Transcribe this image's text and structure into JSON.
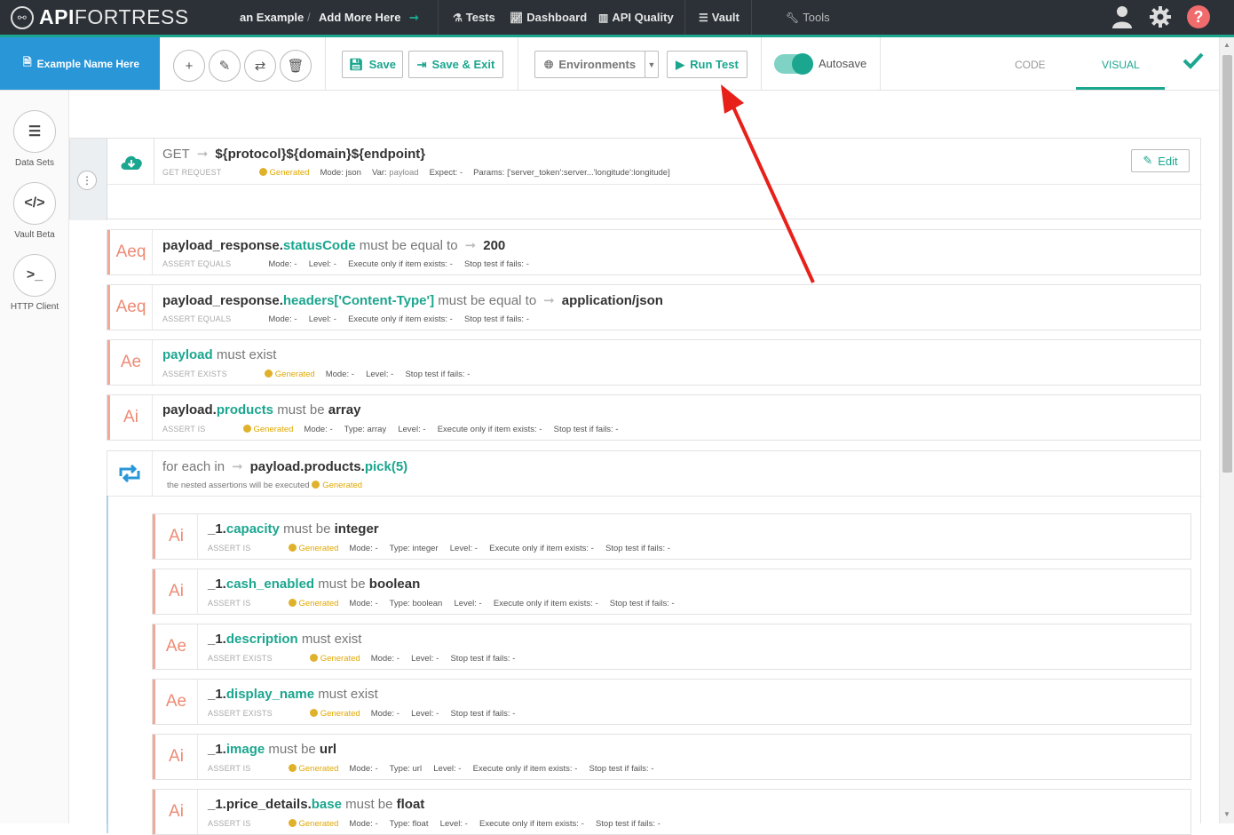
{
  "brand": {
    "bold": "API",
    "thin": "FORTRESS"
  },
  "breadcrumb": {
    "project": "an Example",
    "separator": "/",
    "add": "Add More Here"
  },
  "nav": {
    "tests": "Tests",
    "dashboard": "Dashboard",
    "quality": "API Quality",
    "vault": "Vault",
    "tools": "Tools"
  },
  "test_name": "Example Name Here",
  "toolbar": {
    "save": "Save",
    "save_exit": "Save & Exit",
    "environments": "Environments",
    "run_test": "Run Test",
    "autosave": "Autosave",
    "tab_code": "CODE",
    "tab_visual": "VISUAL"
  },
  "sidebar": {
    "data_sets": "Data Sets",
    "vault": "Vault Beta",
    "http": "HTTP Client"
  },
  "colors": {
    "accent": "#1ba68f",
    "primary": "#2996d8",
    "assert_badge": "#ef8a74",
    "generated": "#e0a800",
    "annotation_arrow": "#e8201a"
  },
  "request": {
    "method": "GET",
    "url": "${protocol}${domain}${endpoint}",
    "caption": "GET REQUEST",
    "generated": "Generated",
    "mode": "Mode: json",
    "var": "Var:",
    "var_val": "payload",
    "expect": "Expect: -",
    "params": "Params: ['server_token':server...'longitude':longitude]",
    "edit": "Edit"
  },
  "rows": [
    {
      "badge": "Aeq",
      "p1": "payload_response.",
      "p2": "statusCode",
      "verb": "must be equal to",
      "value": "200",
      "caption": "ASSERT EQUALS",
      "meta": "Mode: -     Level: -     Execute only if item exists: -     Stop test if fails: -"
    },
    {
      "badge": "Aeq",
      "p1": "payload_response.",
      "p2": "headers['Content-Type']",
      "verb": "must be equal to",
      "value": "application/json",
      "caption": "ASSERT EQUALS",
      "meta": "Mode: -     Level: -     Execute only if item exists: -     Stop test if fails: -"
    },
    {
      "badge": "Ae",
      "p1": "",
      "p2": "payload",
      "verb": "must exist",
      "value": "",
      "caption": "ASSERT EXISTS",
      "meta": "Mode: -     Level: -     Stop test if fails: -"
    },
    {
      "badge": "Ai",
      "p1": "payload.",
      "p2": "products",
      "verb": "must be",
      "value": "array",
      "caption": "ASSERT IS",
      "meta": "Mode: -     Type: array     Level: -     Execute only if item exists: -     Stop test if fails: -"
    }
  ],
  "foreach": {
    "label": "for each in",
    "p1": "payload.products.",
    "p2": "pick(5)",
    "caption": "the nested assertions will be executed",
    "generated": "Generated"
  },
  "nested": [
    {
      "badge": "Ai",
      "p1": "_1.",
      "p2": "capacity",
      "verb": "must be",
      "value": "integer",
      "caption": "ASSERT IS",
      "meta": "Mode: -     Type: integer     Level: -     Execute only if item exists: -     Stop test if fails: -"
    },
    {
      "badge": "Ai",
      "p1": "_1.",
      "p2": "cash_enabled",
      "verb": "must be",
      "value": "boolean",
      "caption": "ASSERT IS",
      "meta": "Mode: -     Type: boolean     Level: -     Execute only if item exists: -     Stop test if fails: -"
    },
    {
      "badge": "Ae",
      "p1": "_1.",
      "p2": "description",
      "verb": "must exist",
      "value": "",
      "caption": "ASSERT EXISTS",
      "meta": "Mode: -     Level: -     Stop test if fails: -"
    },
    {
      "badge": "Ae",
      "p1": "_1.",
      "p2": "display_name",
      "verb": "must exist",
      "value": "",
      "caption": "ASSERT EXISTS",
      "meta": "Mode: -     Level: -     Stop test if fails: -"
    },
    {
      "badge": "Ai",
      "p1": "_1.",
      "p2": "image",
      "verb": "must be",
      "value": "url",
      "caption": "ASSERT IS",
      "meta": "Mode: -     Type: url     Level: -     Execute only if item exists: -     Stop test if fails: -"
    },
    {
      "badge": "Ai",
      "p1": "_1.price_details.",
      "p2": "base",
      "verb": "must be",
      "value": "float",
      "caption": "ASSERT IS",
      "meta": "Mode: -     Type: float     Level: -     Execute only if item exists: -     Stop test if fails: -"
    }
  ],
  "generated_label": "Generated"
}
